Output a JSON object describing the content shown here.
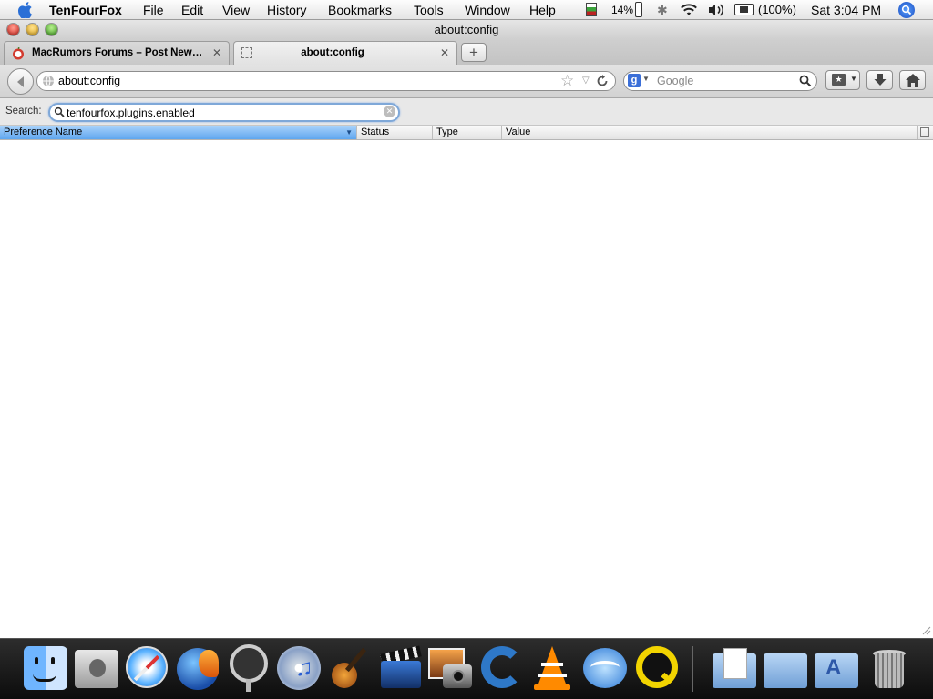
{
  "menubar": {
    "app_name": "TenFourFox",
    "menus": [
      "File",
      "Edit",
      "View",
      "History",
      "Bookmarks",
      "Tools",
      "Window",
      "Help"
    ],
    "status": {
      "cpu_percent": "14%",
      "battery_text": "(100%)",
      "clock": "Sat 3:04 PM"
    }
  },
  "window": {
    "title": "about:config"
  },
  "tabs": [
    {
      "label": "MacRumors Forums – Post New…",
      "active": false
    },
    {
      "label": "about:config",
      "active": true
    }
  ],
  "navbar": {
    "url": "about:config",
    "search_engine": "Google",
    "search_placeholder": "Google"
  },
  "config": {
    "search_label": "Search:",
    "search_value": "tenfourfox.plugins.enabled",
    "columns": [
      "Preference Name",
      "Status",
      "Type",
      "Value"
    ],
    "sorted_column": "Preference Name",
    "rows": []
  },
  "dock": {
    "apps": [
      "Finder",
      "System Preferences",
      "Safari",
      "TenFourFox",
      "Spotlight",
      "iTunes",
      "GarageBand",
      "iMovie",
      "iPhoto",
      "Camino",
      "VLC",
      "Keynote",
      "Quicksilver",
      "Documents",
      "Folder",
      "Applications",
      "Trash"
    ]
  },
  "colors": {
    "sorted_header": "#5fa6ef",
    "filter_focus": "#7fa8d8",
    "dock_bg": "#111111"
  }
}
